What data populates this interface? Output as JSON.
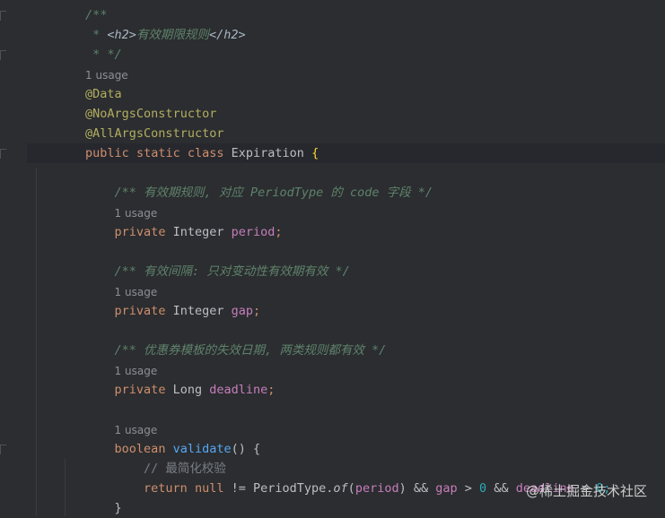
{
  "editor": {
    "usage_label": "1 usage",
    "doc_open": "/**",
    "doc_star": " * ",
    "doc_tag_open": "<h2>",
    "doc_title": "有效期限规则",
    "doc_tag_close": "</h2>",
    "doc_close": " * */",
    "ann_data": "@Data",
    "ann_noargs": "@NoArgsConstructor",
    "ann_allargs": "@AllArgsConstructor",
    "class_kw_public": "public",
    "class_kw_static": "static",
    "class_kw_class": "class",
    "class_name": "Expiration",
    "open_brace": "{",
    "period_doc": "/** 有效期规则, 对应 PeriodType 的 code 字段 */",
    "period_kw": "private",
    "period_type": "Integer",
    "period_name": "period",
    "gap_doc": "/** 有效间隔: 只对变动性有效期有效 */",
    "gap_kw": "private",
    "gap_type": "Integer",
    "gap_name": "gap",
    "deadline_doc": "/** 优惠券模板的失效日期, 两类规则都有效 */",
    "deadline_kw": "private",
    "deadline_type": "Long",
    "deadline_name": "deadline",
    "validate_type": "boolean",
    "validate_name": "validate",
    "validate_rest": "() {",
    "validate_comment": "// 最简化校验",
    "ret_kw": "return",
    "ret_null": "null",
    "ret_ne": " != ",
    "ret_cls": "PeriodType.",
    "ret_of": "of",
    "ret_paren_open": "(",
    "ret_period": "period",
    "ret_paren_close": ")",
    "ret_and1": " && ",
    "ret_gap": "gap",
    "ret_gt1": " > ",
    "ret_zero": "0",
    "ret_and2": " && ",
    "ret_deadline": "deadline",
    "ret_gt2": " > ",
    "ret_tail": "0;",
    "close_brace": "}"
  },
  "watermark": "@稀土掘金技术社区"
}
